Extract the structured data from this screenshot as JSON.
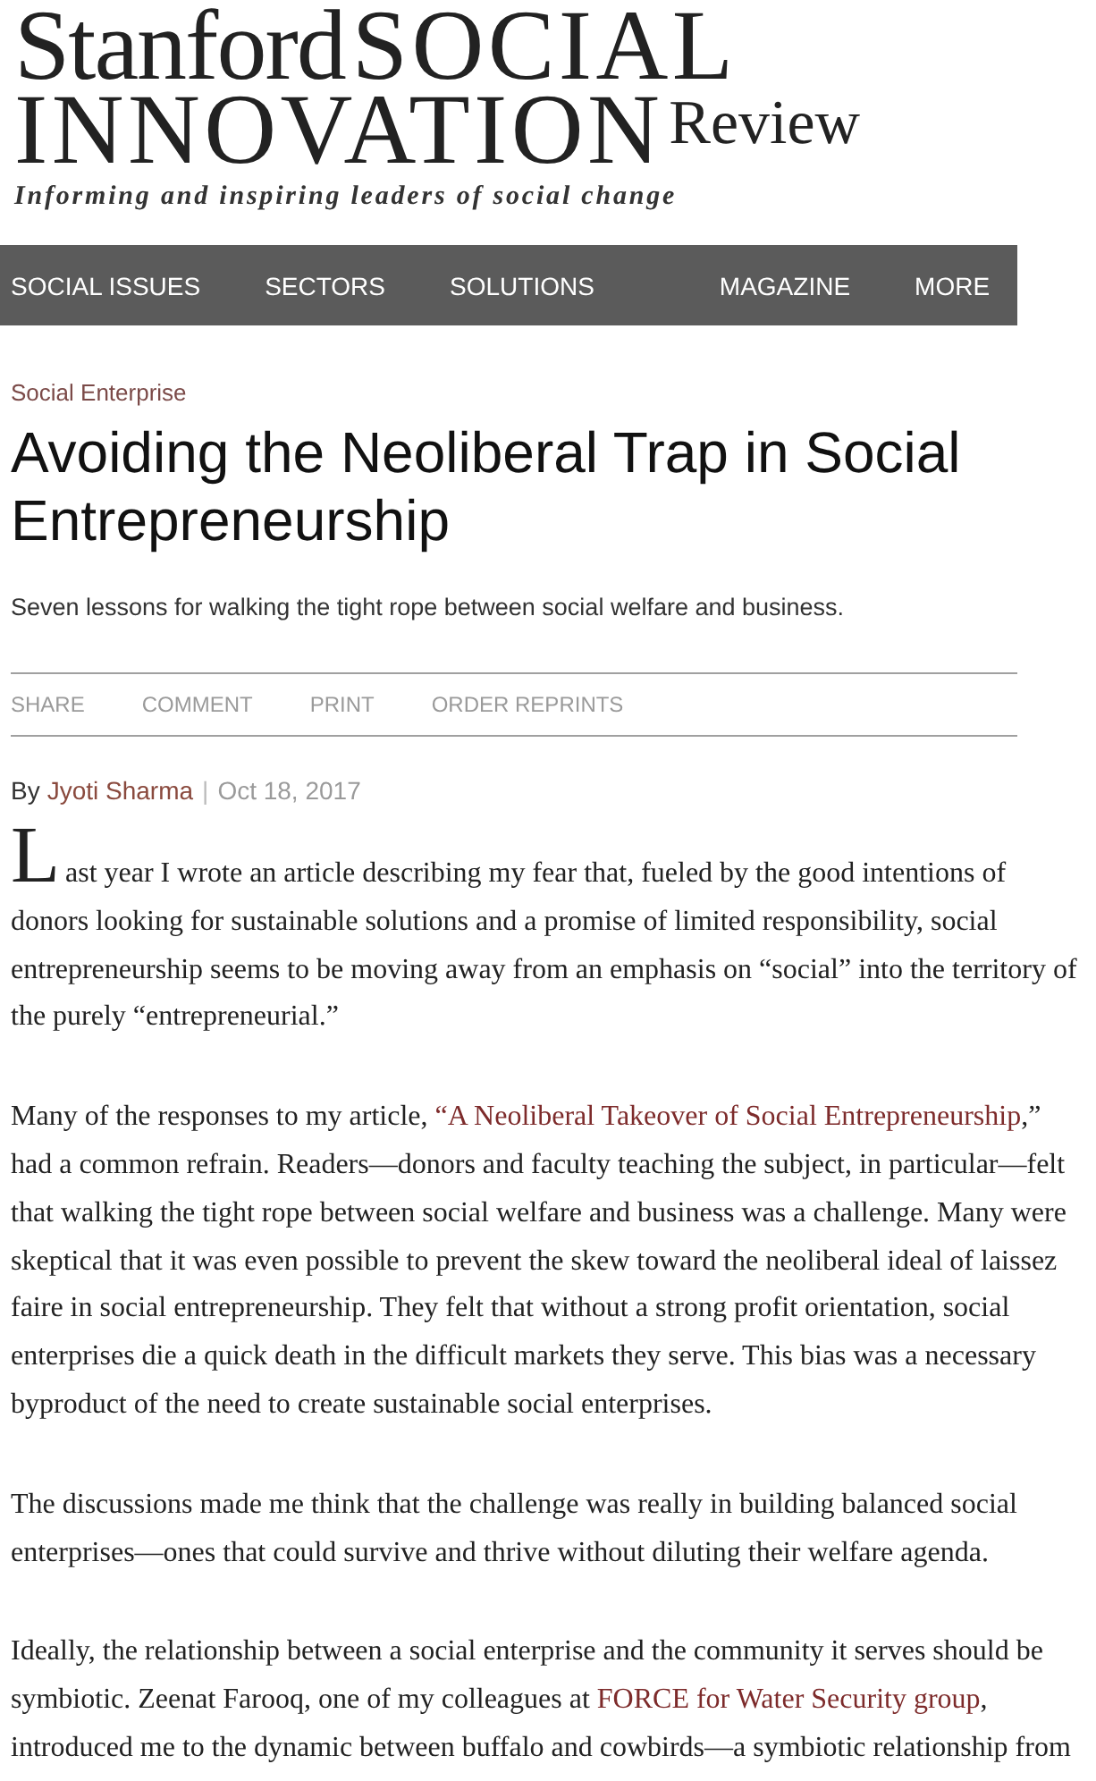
{
  "logo": {
    "name": "Stanford",
    "title_1": "SOCIAL",
    "title_2": "INNOVATION",
    "suffix": "Review",
    "tagline": "Informing and inspiring leaders of social change"
  },
  "nav": {
    "primary": [
      "SOCIAL ISSUES",
      "SECTORS",
      "SOLUTIONS"
    ],
    "secondary": [
      "MAGAZINE",
      "MORE"
    ]
  },
  "article": {
    "category": "Social Enterprise",
    "title": "Avoiding the Neoliberal Trap in Social Entrepreneurship",
    "subtitle": "Seven lessons for walking the tight rope between social welfare and business.",
    "actions": [
      "SHARE",
      "COMMENT",
      "PRINT",
      "ORDER REPRINTS"
    ],
    "byline": {
      "prefix": "By",
      "author": "Jyoti Sharma",
      "separator": "|",
      "date": "Oct 18, 2017"
    },
    "paragraphs": [
      {
        "kind": "lead",
        "parts": [
          {
            "kind": "text",
            "text": "Last year I wrote an article describing my fear that, fueled by the good intentions of donors looking for sustainable solutions and a promise of limited responsibility, social entrepreneurship seems to be moving away from an emphasis on “social” into the territory of the purely “entrepreneurial.”"
          }
        ]
      },
      {
        "kind": "body",
        "parts": [
          {
            "kind": "text",
            "text": "Many of the responses to my article, "
          },
          {
            "kind": "link",
            "text": "“A Neoliberal Takeover of Social Entrepreneurship"
          },
          {
            "kind": "text",
            "text": ",” had a common refrain. Readers—donors and faculty teaching the subject, in particular—felt that walking the tight rope between social welfare and business was a challenge. Many were skeptical that it was even possible to prevent the skew toward the neoliberal ideal of laissez faire in social entrepreneurship. They felt that without a strong profit orientation, social enterprises die a quick death in the difficult markets they serve. This bias was a necessary byproduct of the need to create sustainable social enterprises."
          }
        ]
      },
      {
        "kind": "body",
        "parts": [
          {
            "kind": "text",
            "text": "The discussions made me think that the challenge was really in building balanced social enterprises—ones that could survive and thrive without diluting their welfare agenda."
          }
        ]
      },
      {
        "kind": "body",
        "parts": [
          {
            "kind": "text",
            "text": "Ideally, the relationship between a social enterprise and the community it serves should be symbiotic. Zeenat Farooq, one of my colleagues at "
          },
          {
            "kind": "link",
            "text": "FORCE for Water Security group"
          },
          {
            "kind": "text",
            "text": ", introduced me to the dynamic between buffalo and cowbirds—a symbiotic relationship from"
          }
        ]
      }
    ]
  }
}
